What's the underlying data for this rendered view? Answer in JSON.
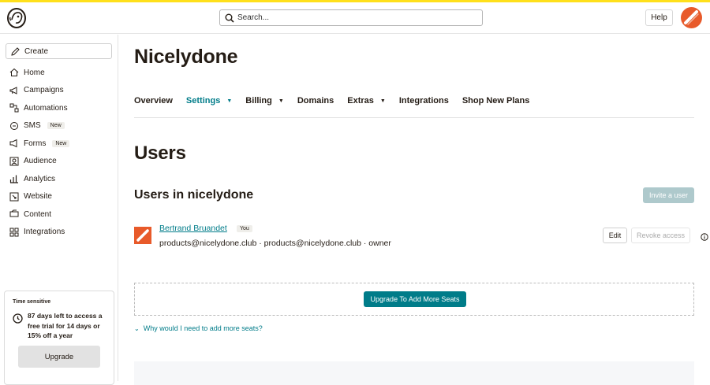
{
  "search": {
    "placeholder": "Search..."
  },
  "header": {
    "help_label": "Help"
  },
  "sidebar": {
    "create_label": "Create",
    "items": [
      {
        "label": "Home",
        "icon": "home-icon"
      },
      {
        "label": "Campaigns",
        "icon": "megaphone-icon"
      },
      {
        "label": "Automations",
        "icon": "automations-icon"
      },
      {
        "label": "SMS",
        "icon": "sms-icon",
        "badge": "New"
      },
      {
        "label": "Forms",
        "icon": "forms-icon",
        "badge": "New"
      },
      {
        "label": "Audience",
        "icon": "audience-icon"
      },
      {
        "label": "Analytics",
        "icon": "analytics-icon"
      },
      {
        "label": "Website",
        "icon": "website-icon"
      },
      {
        "label": "Content",
        "icon": "content-icon"
      },
      {
        "label": "Integrations",
        "icon": "integrations-icon"
      }
    ],
    "trial": {
      "label": "Time sensitive",
      "text": "87 days left to access a free trial for 14 days or 15% off a year",
      "upgrade_label": "Upgrade"
    }
  },
  "main": {
    "org_name": "Nicelydone",
    "tabs": [
      {
        "label": "Overview",
        "active": false,
        "dropdown": false
      },
      {
        "label": "Settings",
        "active": true,
        "dropdown": true
      },
      {
        "label": "Billing",
        "active": false,
        "dropdown": true
      },
      {
        "label": "Domains",
        "active": false,
        "dropdown": false
      },
      {
        "label": "Extras",
        "active": false,
        "dropdown": true
      },
      {
        "label": "Integrations",
        "active": false,
        "dropdown": false
      },
      {
        "label": "Shop New Plans",
        "active": false,
        "dropdown": false
      }
    ],
    "users_title": "Users",
    "users_in_title": "Users in nicelydone",
    "invite_label": "Invite a user",
    "user": {
      "name": "Bertrand Bruandet",
      "you_badge": "You",
      "meta": "products@nicelydone.club · products@nicelydone.club · owner",
      "edit_label": "Edit",
      "revoke_label": "Revoke access"
    },
    "seats_button_label": "Upgrade To Add More Seats",
    "why_link": "Why would I need to add more seats?"
  },
  "colors": {
    "accent": "#007c89",
    "brand_yellow": "#ffe01b",
    "avatar_orange": "#e85a2a"
  }
}
